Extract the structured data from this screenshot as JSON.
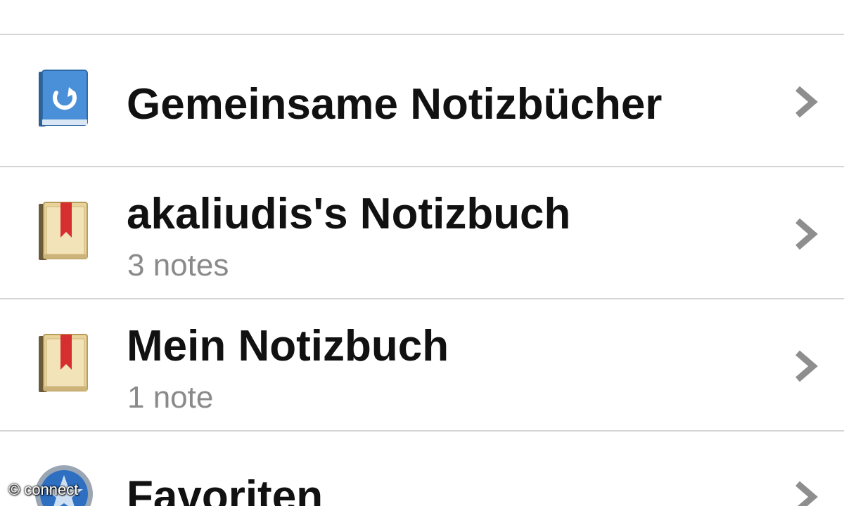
{
  "notebooks": {
    "items": [
      {
        "title": "Gemeinsame Notizbücher",
        "subtitle": "",
        "icon": "shared-notebook-icon"
      },
      {
        "title": "akaliudis's Notizbuch",
        "subtitle": "3 notes",
        "icon": "notebook-icon"
      },
      {
        "title": "Mein Notizbuch",
        "subtitle": "1 note",
        "icon": "notebook-icon"
      },
      {
        "title": "Favoriten",
        "subtitle": "",
        "icon": "star-icon"
      }
    ]
  },
  "colors": {
    "shared_book": "#4a90d9",
    "notebook_cover": "#e8d39a",
    "bookmark": "#d62f2f",
    "star_badge": "#2f6fc2",
    "subtitle": "#8a8a8a",
    "chevron": "#8e8e8e",
    "divider": "#d4d4d4"
  },
  "watermark": "© connect"
}
